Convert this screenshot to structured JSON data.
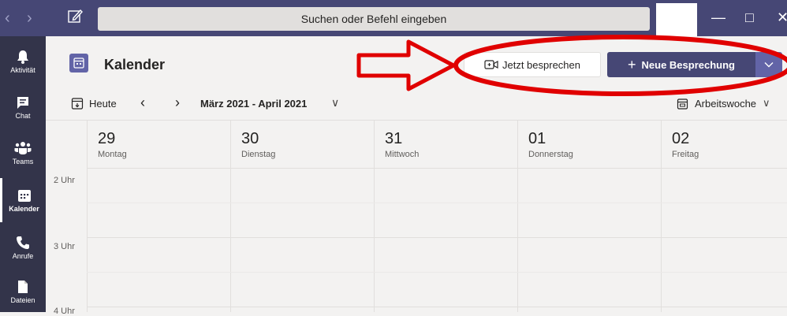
{
  "search": {
    "placeholder": "Suchen oder Befehl eingeben"
  },
  "nav": [
    {
      "label": "Aktivität"
    },
    {
      "label": "Chat"
    },
    {
      "label": "Teams"
    },
    {
      "label": "Kalender"
    },
    {
      "label": "Anrufe"
    },
    {
      "label": "Dateien"
    }
  ],
  "header": {
    "title": "Kalender",
    "meet_now_label": "Jetzt besprechen",
    "new_meeting_label": "Neue Besprechung"
  },
  "toolbar": {
    "today_label": "Heute",
    "date_range": "März 2021 - April 2021",
    "view_label": "Arbeitswoche"
  },
  "days": [
    {
      "num": "29",
      "name": "Montag"
    },
    {
      "num": "30",
      "name": "Dienstag"
    },
    {
      "num": "31",
      "name": "Mittwoch"
    },
    {
      "num": "01",
      "name": "Donnerstag"
    },
    {
      "num": "02",
      "name": "Freitag"
    }
  ],
  "hours": [
    "2 Uhr",
    "3 Uhr",
    "4 Uhr"
  ],
  "colors": {
    "titlebar": "#464775",
    "leftnav": "#33344a",
    "accent": "#6264a7",
    "annotation": "#e00000"
  },
  "icons": {
    "compose": "compose-icon",
    "activity": "bell-icon",
    "chat": "chat-icon",
    "teams": "teams-icon",
    "calendar": "calendar-icon",
    "calls": "phone-icon",
    "files": "file-icon",
    "meet_now": "video-camera-icon",
    "today": "calendar-today-icon",
    "view": "calendar-week-icon"
  }
}
